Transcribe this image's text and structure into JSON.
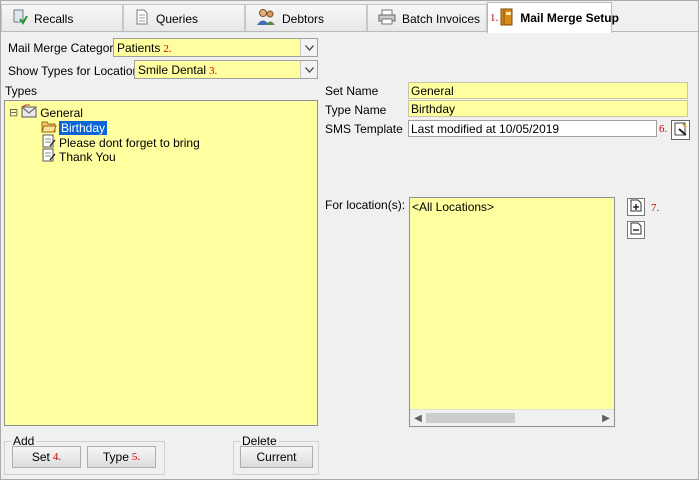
{
  "tabs": [
    {
      "label": "Recalls",
      "icon": "recall-icon"
    },
    {
      "label": "Queries",
      "icon": "document-icon"
    },
    {
      "label": "Debtors",
      "icon": "people-icon"
    },
    {
      "label": "Batch Invoices",
      "icon": "printer-icon"
    },
    {
      "label": "Mail Merge Setup",
      "icon": "book-icon",
      "marker": "1.",
      "active": true
    }
  ],
  "form": {
    "category_label": "Mail Merge Category",
    "category_value": "Patients",
    "category_marker": "2.",
    "location_label": "Show Types for Location",
    "location_value": "Smile Dental",
    "location_marker": "3."
  },
  "types": {
    "title": "Types",
    "expander": "⊟",
    "root": "General",
    "children": [
      "Birthday",
      "Please dont forget to bring",
      "Thank You"
    ],
    "selected": "Birthday"
  },
  "add_group": {
    "title": "Add",
    "set_label": "Set",
    "set_marker": "4.",
    "type_label": "Type",
    "type_marker": "5."
  },
  "delete_group": {
    "title": "Delete",
    "current_label": "Current"
  },
  "details": {
    "set_name_label": "Set Name",
    "set_name_value": "General",
    "type_name_label": "Type Name",
    "type_name_value": "Birthday",
    "sms_label": "SMS Template",
    "sms_value": "Last modified at 10/05/2019",
    "sms_marker": "6.",
    "locations_label": "For location(s):",
    "locations": [
      "<All Locations>"
    ],
    "locations_marker": "7."
  },
  "colors": {
    "field_bg": "#ffffa0",
    "selection": "#0a64d8",
    "marker": "#d00000"
  }
}
